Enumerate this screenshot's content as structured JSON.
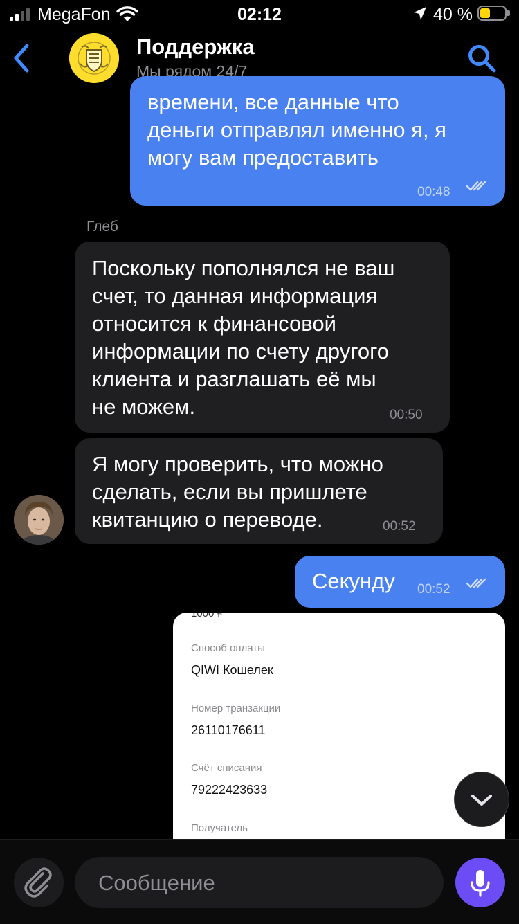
{
  "status_bar": {
    "carrier": "MegaFon",
    "time": "02:12",
    "battery_percent": "40 %"
  },
  "header": {
    "title": "Поддержка",
    "subtitle": "Мы рядом 24/7"
  },
  "messages": [
    {
      "text": "времени, все данные что\nденьги отправлял именно я, я\nмогу вам предоставить",
      "time": "00:48",
      "status": "read"
    },
    {
      "sender": "Глеб",
      "text": "Поскольку пополнялся не ваш\nсчет, то данная информация\nотносится к финансовой\nинформации по счету другого\nклиента и разглашать её мы\nне можем.",
      "time": "00:50"
    },
    {
      "text": "Я могу проверить, что можно\nсделать, если вы пришлете\nквитанцию о переводе.",
      "time": "00:52"
    },
    {
      "text": "Секунду",
      "time": "00:52",
      "status": "read"
    }
  ],
  "receipt": {
    "top_text": "1000 ₽",
    "fields": [
      {
        "label": "Способ оплаты",
        "value": "QIWI Кошелек"
      },
      {
        "label": "Номер транзакции",
        "value": "26110176611"
      },
      {
        "label": "Счёт списания",
        "value": "79222423633"
      },
      {
        "label": "Получатель",
        "value": ""
      }
    ]
  },
  "input": {
    "placeholder": "Сообщение"
  },
  "colors": {
    "outgoing_bubble": "#4a81f0",
    "incoming_bubble": "#1f1f21",
    "accent": "#3e8bff",
    "mic_button": "#6c4df5",
    "logo_yellow": "#ffdd2d"
  },
  "icons": {
    "back": "chevron-left-icon",
    "search": "search-icon",
    "attach": "paperclip-icon",
    "mic": "microphone-icon",
    "scroll": "chevron-down-icon",
    "read": "double-check-icon"
  }
}
